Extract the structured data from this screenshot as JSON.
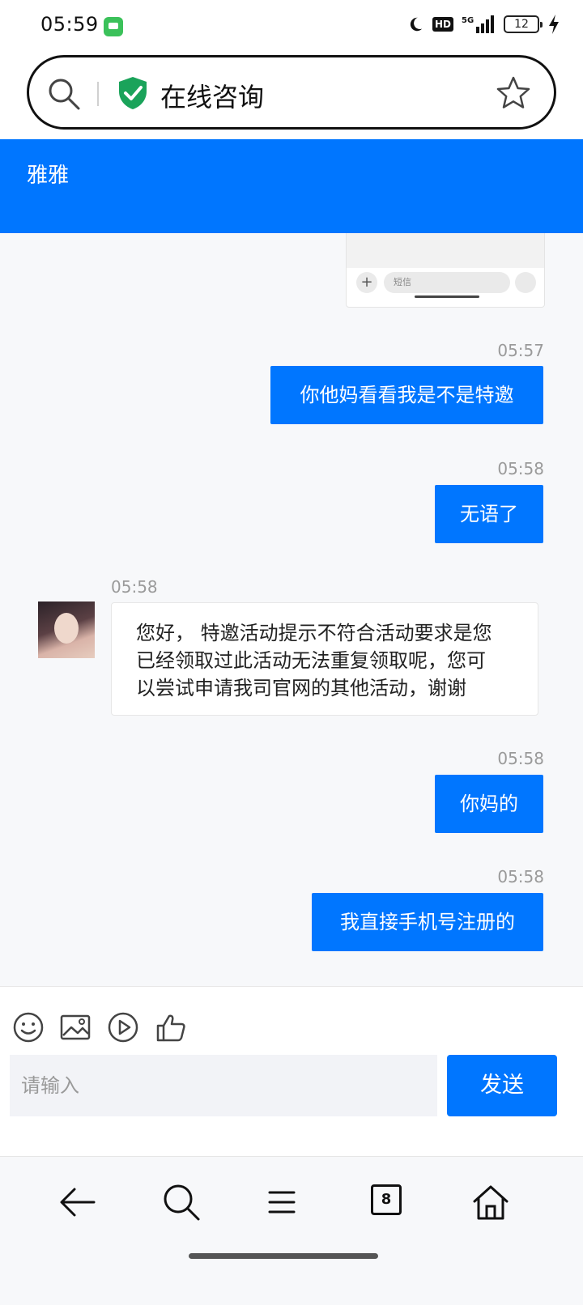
{
  "status_bar": {
    "time": "05:59",
    "network": "5G",
    "hd": "HD",
    "battery": "12"
  },
  "url_bar": {
    "title": "在线咨询"
  },
  "chat_header": {
    "agent_name": "雅雅"
  },
  "image_preview": {
    "input_placeholder": "短信",
    "plus": "+"
  },
  "messages": [
    {
      "time": "05:57",
      "text": "你他妈看看我是不是特邀",
      "from": "user"
    },
    {
      "time": "05:58",
      "text": "无语了",
      "from": "user"
    },
    {
      "time": "05:58",
      "lines": [
        "您好， 特邀活动提示不符合活动要求是您",
        "已经领取过此活动无法重复领取呢，您可",
        "以尝试申请我司官网的其他活动，谢谢"
      ],
      "from": "agent"
    },
    {
      "time": "05:58",
      "text": "你妈的",
      "from": "user"
    },
    {
      "time": "05:58",
      "text": "我直接手机号注册的",
      "from": "user"
    }
  ],
  "composer": {
    "placeholder": "请输入",
    "send_label": "发送"
  },
  "toolbar_icons": [
    "emoji-icon",
    "image-icon",
    "video-icon",
    "thumbs-up-icon"
  ],
  "bottom_nav": {
    "tabs_count": "8"
  },
  "colors": {
    "accent": "#0076ff",
    "shield": "#1aa35a"
  }
}
